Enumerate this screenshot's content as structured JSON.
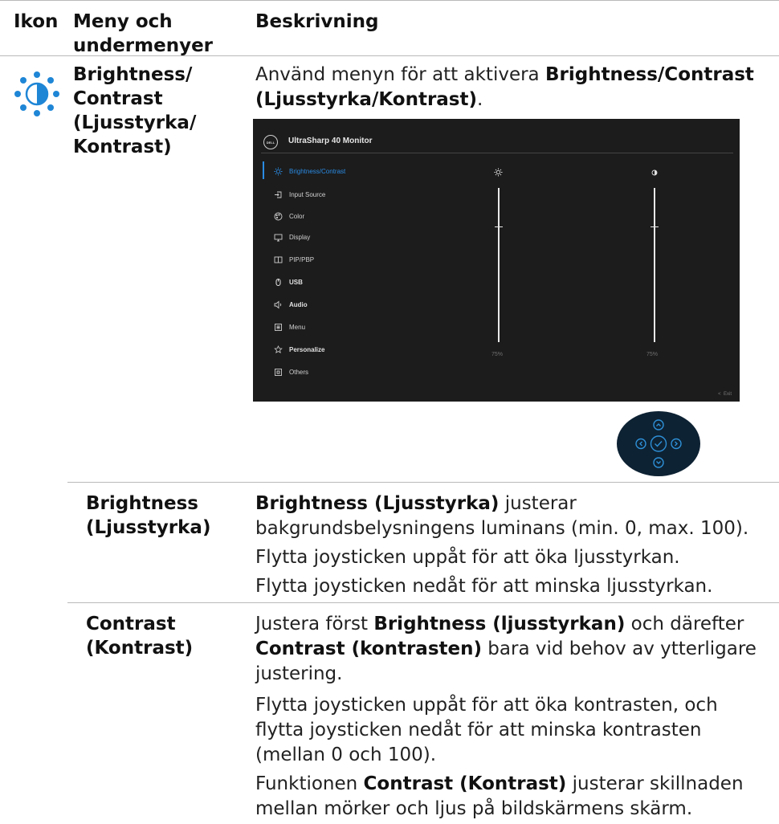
{
  "headers": {
    "col1": "Ikon",
    "col2": "Meny och undermenyer",
    "col3": "Beskrivning"
  },
  "row_main": {
    "menu_name": "Brightness/ Contrast (Ljusstyrka/ Kontrast)",
    "intro_pre": "Använd menyn för att aktivera ",
    "intro_bold": "Brightness/Contrast (Ljusstyrka/Kontrast)",
    "intro_post": "."
  },
  "osd": {
    "logo": "DELL",
    "title": "UltraSharp 40 Monitor",
    "menu_items": [
      {
        "label": "Brightness/Contrast",
        "icon": "brightness-icon",
        "state": "selected"
      },
      {
        "label": "Input Source",
        "icon": "input-source-icon",
        "state": "normal"
      },
      {
        "label": "Color",
        "icon": "color-palette-icon",
        "state": "normal"
      },
      {
        "label": "Display",
        "icon": "display-icon",
        "state": "normal"
      },
      {
        "label": "PIP/PBP",
        "icon": "pip-icon",
        "state": "normal"
      },
      {
        "label": "USB",
        "icon": "mouse-icon",
        "state": "bold"
      },
      {
        "label": "Audio",
        "icon": "speaker-icon",
        "state": "bold"
      },
      {
        "label": "Menu",
        "icon": "menu-icon",
        "state": "normal"
      },
      {
        "label": "Personalize",
        "icon": "star-icon",
        "state": "bold"
      },
      {
        "label": "Others",
        "icon": "others-icon",
        "state": "normal"
      }
    ],
    "brightness_value": "75%",
    "contrast_value": "75%",
    "brightness_level": 0.75,
    "contrast_level": 0.75,
    "exit_label": "Exit",
    "accent_color": "#2a8be3"
  },
  "row_brightness": {
    "name": "Brightness (Ljusstyrka)",
    "p1_bold": "Brightness (Ljusstyrka)",
    "p1_rest": " justerar bakgrundsbelysningens luminans (min. 0, max. 100).",
    "p2": "Flytta joysticken uppåt för att öka ljusstyrkan.",
    "p3": "Flytta joysticken nedåt för att minska ljusstyrkan."
  },
  "row_contrast": {
    "name": "Contrast (Kontrast)",
    "p1_pre": "Justera först ",
    "p1_bold1": "Brightness (ljusstyrkan)",
    "p1_mid": " och därefter ",
    "p1_bold2": "Contrast (kontrasten)",
    "p1_post": " bara vid behov av ytterligare justering.",
    "p2": "Flytta joysticken uppåt för att öka kontrasten, och flytta joysticken nedåt för att minska kontrasten (mellan 0 och 100).",
    "p3_pre": "Funktionen ",
    "p3_bold": "Contrast (Kontrast)",
    "p3_post": " justerar skillnaden mellan mörker och ljus på bildskärmens skärm."
  },
  "icon_color": "#1f86d6"
}
